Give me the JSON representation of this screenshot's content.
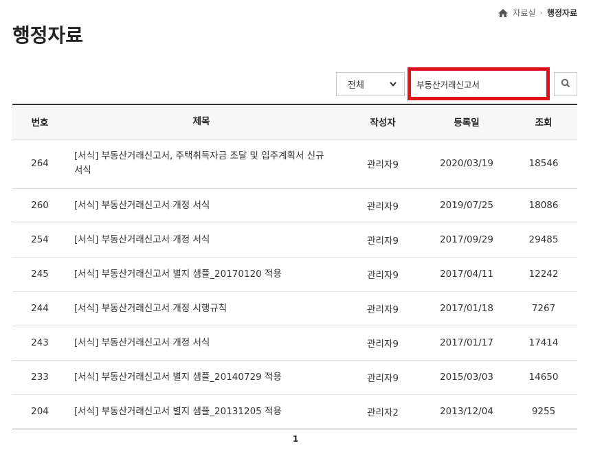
{
  "breadcrumb": {
    "home_icon": "home-icon",
    "parent": "자료실",
    "separator": "›",
    "current": "행정자료"
  },
  "page": {
    "title": "행정자료"
  },
  "search": {
    "filter_selected": "전체",
    "query": "부동산거래신고서",
    "button_icon": "search-icon",
    "highlight_color": "#e0111a"
  },
  "table": {
    "headers": {
      "no": "번호",
      "title": "제목",
      "writer": "작성자",
      "date": "등록일",
      "views": "조회"
    },
    "rows": [
      {
        "no": "264",
        "title": "[서식] 부동산거래신고서, 주택취득자금 조달 및 입주계획서 신규 서식",
        "writer": "관리자9",
        "date": "2020/03/19",
        "views": "18546"
      },
      {
        "no": "260",
        "title": "[서식] 부동산거래신고서 개정 서식",
        "writer": "관리자9",
        "date": "2019/07/25",
        "views": "18086"
      },
      {
        "no": "254",
        "title": "[서식] 부동산거래신고서 개정 서식",
        "writer": "관리자9",
        "date": "2017/09/29",
        "views": "29485"
      },
      {
        "no": "245",
        "title": "[서식] 부동산거래신고서 별지 샘플_20170120 적용",
        "writer": "관리자9",
        "date": "2017/04/11",
        "views": "12242"
      },
      {
        "no": "244",
        "title": "[서식] 부동산거래신고서 개정 시행규칙",
        "writer": "관리자9",
        "date": "2017/01/18",
        "views": "7267"
      },
      {
        "no": "243",
        "title": "[서식] 부동산거래신고서 개정 서식",
        "writer": "관리자9",
        "date": "2017/01/17",
        "views": "17414"
      },
      {
        "no": "233",
        "title": "[서식] 부동산거래신고서 별지 샘플_20140729 적용",
        "writer": "관리자9",
        "date": "2015/03/03",
        "views": "14650"
      },
      {
        "no": "204",
        "title": "[서식] 부동산거래신고서 별지 샘플_20131205 적용",
        "writer": "관리자2",
        "date": "2013/12/04",
        "views": "9255"
      }
    ]
  },
  "pagination": {
    "current_page": "1"
  }
}
